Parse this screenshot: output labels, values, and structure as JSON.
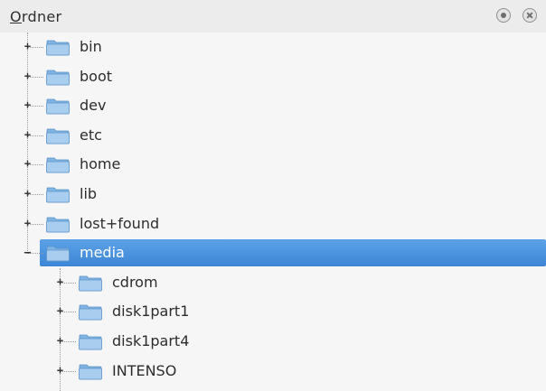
{
  "panel": {
    "title_mnemonic": "O",
    "title_rest": "rdner",
    "float_button_icon": "float-icon",
    "close_button_icon": "close-icon"
  },
  "colors": {
    "selection": "#3d86d6",
    "folder_body": "#7fb4e3",
    "folder_tab": "#a9cdee"
  },
  "tree": {
    "items": [
      {
        "label": "bin",
        "expander": "+",
        "level": 0
      },
      {
        "label": "boot",
        "expander": "+",
        "level": 0
      },
      {
        "label": "dev",
        "expander": "+",
        "level": 0
      },
      {
        "label": "etc",
        "expander": "+",
        "level": 0
      },
      {
        "label": "home",
        "expander": "+",
        "level": 0
      },
      {
        "label": "lib",
        "expander": "+",
        "level": 0
      },
      {
        "label": "lost+found",
        "expander": "+",
        "level": 0
      },
      {
        "label": "media",
        "expander": "–",
        "level": 0,
        "selected": true
      },
      {
        "label": "cdrom",
        "expander": "+",
        "level": 1
      },
      {
        "label": "disk1part1",
        "expander": "+",
        "level": 1
      },
      {
        "label": "disk1part4",
        "expander": "+",
        "level": 1
      },
      {
        "label": "INTENSO",
        "expander": "+",
        "level": 1
      }
    ]
  }
}
